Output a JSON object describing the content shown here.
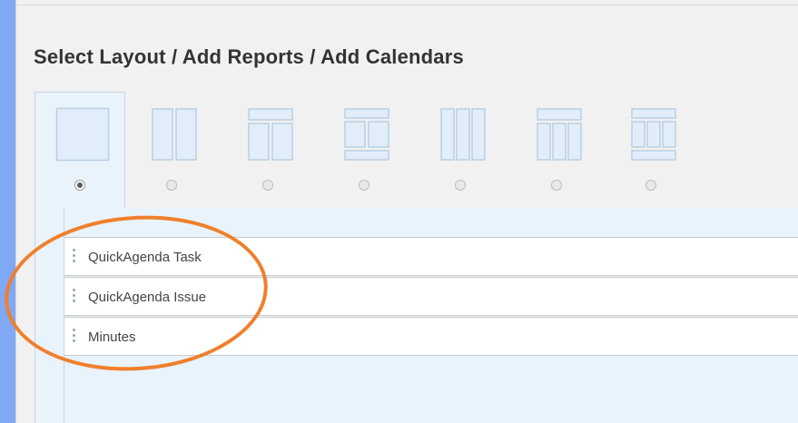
{
  "page": {
    "title": "Select Layout / Add Reports / Add Calendars"
  },
  "layouts": [
    {
      "name": "one-column",
      "selected": true
    },
    {
      "name": "two-columns",
      "selected": false
    },
    {
      "name": "header-two-columns",
      "selected": false
    },
    {
      "name": "header-two-columns-footer",
      "selected": false
    },
    {
      "name": "three-columns",
      "selected": false
    },
    {
      "name": "header-three-columns",
      "selected": false
    },
    {
      "name": "header-three-columns-footer",
      "selected": false
    }
  ],
  "reports": {
    "items": [
      {
        "label": "QuickAgenda Task"
      },
      {
        "label": "QuickAgenda Issue"
      },
      {
        "label": "Minutes"
      }
    ]
  },
  "colors": {
    "annotation": "#f07f2c",
    "layout_fill": "#e1eefa",
    "layout_stroke": "#b9cfe2",
    "background": "#7fa8f5"
  }
}
